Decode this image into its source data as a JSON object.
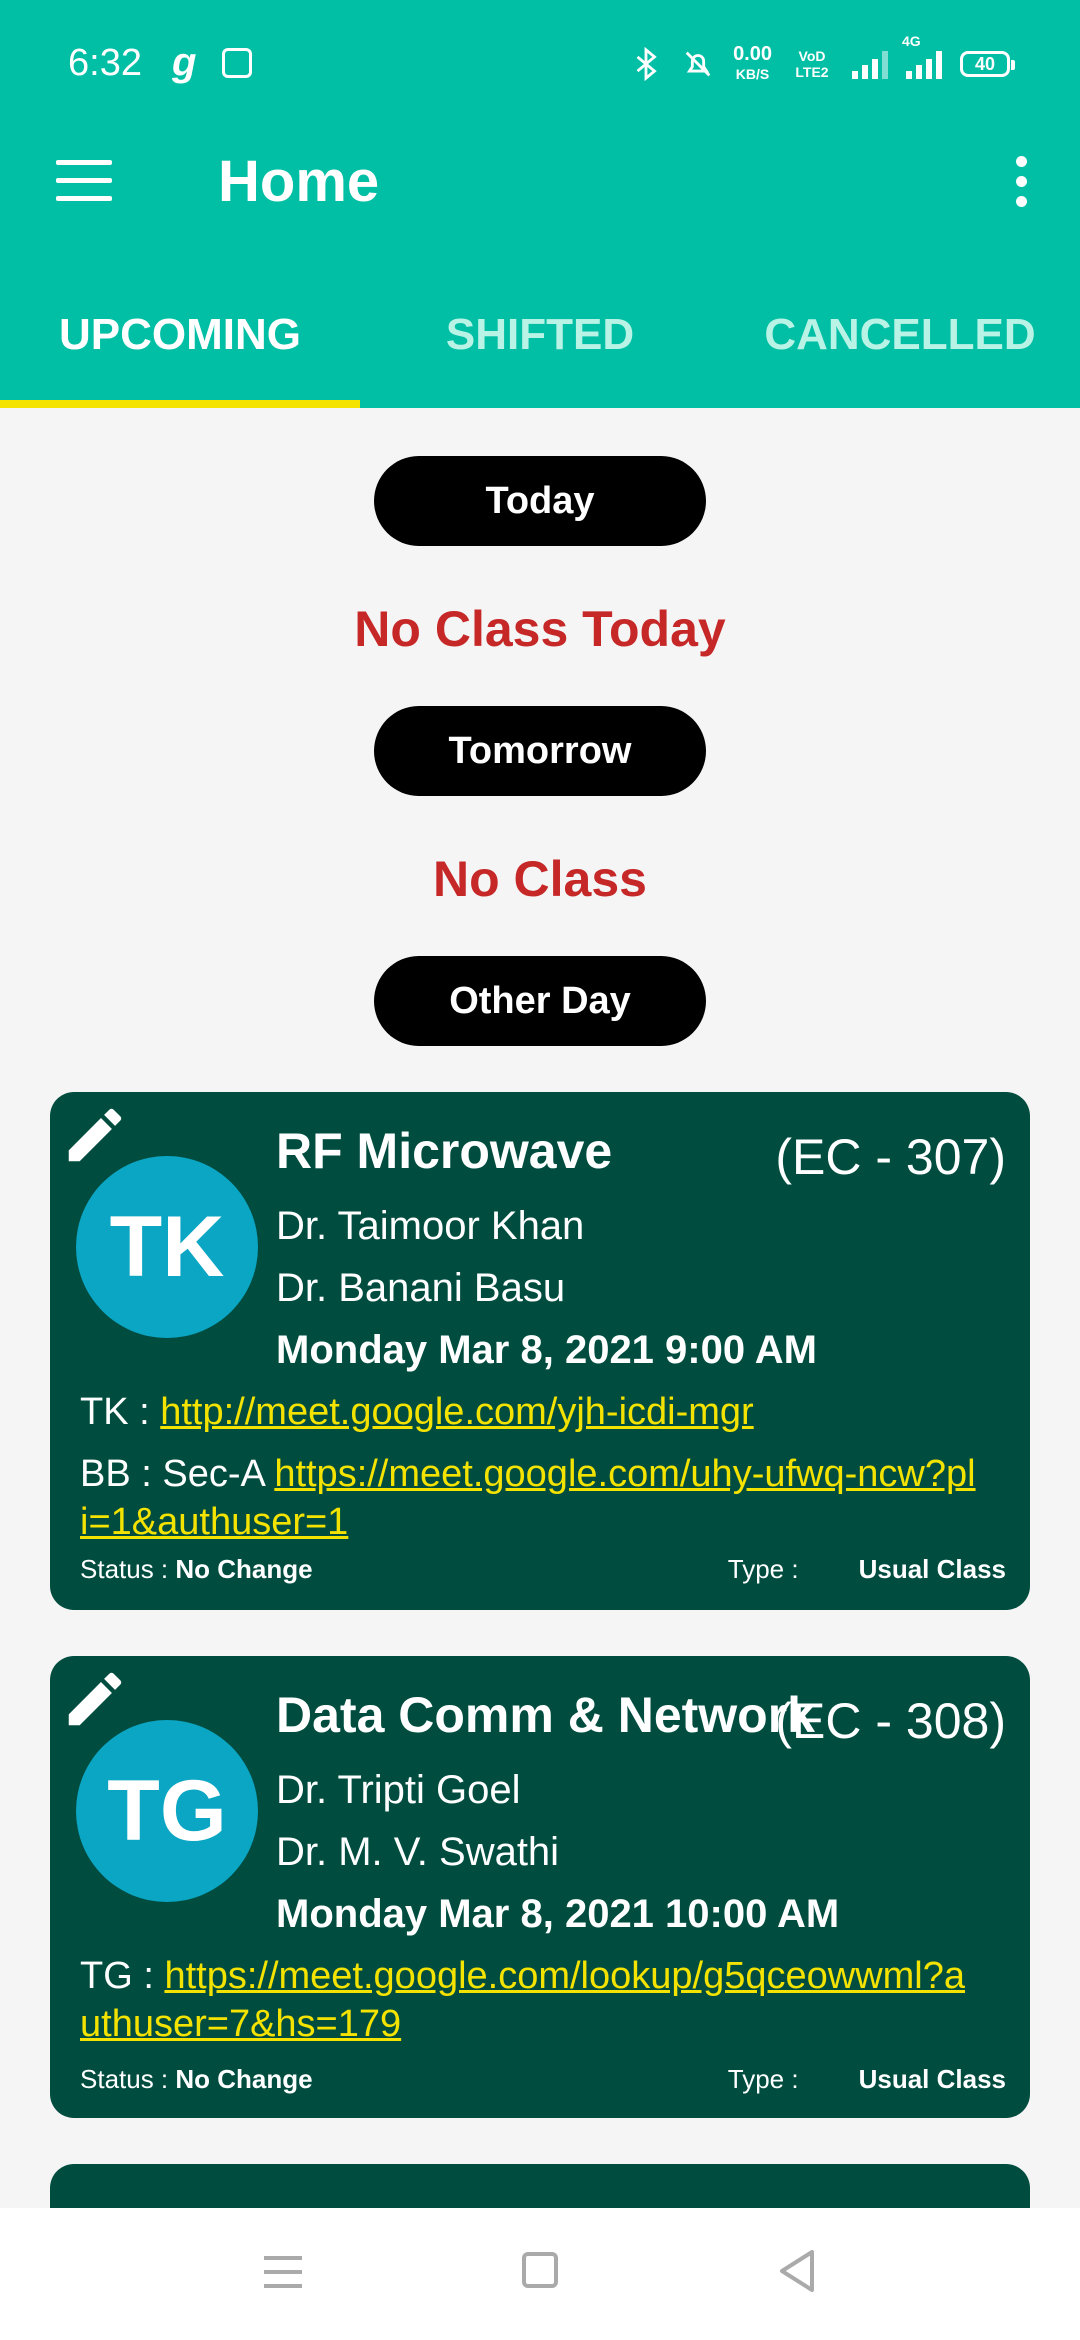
{
  "status_bar": {
    "time": "6:32",
    "speed": "0.00",
    "speed_unit": "KB/S",
    "volte": "VoD LTE2",
    "network": "4G",
    "battery": "40"
  },
  "toolbar": {
    "title": "Home"
  },
  "tabs": [
    {
      "label": "UPCOMING",
      "active": true
    },
    {
      "label": "SHIFTED",
      "active": false
    },
    {
      "label": "CANCELLED",
      "active": false
    }
  ],
  "sections": {
    "today_label": "Today",
    "today_message": "No Class Today",
    "tomorrow_label": "Tomorrow",
    "tomorrow_message": "No Class",
    "other_day_label": "Other Day"
  },
  "classes": [
    {
      "initials": "TK",
      "subject": "RF Microwave",
      "code": "(EC - 307)",
      "teachers": [
        "Dr. Taimoor Khan",
        "Dr. Banani Basu"
      ],
      "datetime": "Monday Mar 8, 2021 9:00 AM",
      "links": [
        {
          "prefix": "TK : ",
          "url": "http://meet.google.com/yjh-icdi-mgr"
        },
        {
          "prefix": "BB : Sec-A ",
          "url": "https://meet.google.com/uhy-ufwq-ncw?pli=1&authuser=1"
        }
      ],
      "status_label": "Status : ",
      "status_value": "No Change",
      "type_label": "Type :",
      "type_value": "Usual Class"
    },
    {
      "initials": "TG",
      "subject": "Data Comm & Network",
      "code": "(EC - 308)",
      "teachers": [
        "Dr. Tripti Goel",
        "Dr. M. V. Swathi"
      ],
      "datetime": "Monday Mar 8, 2021 10:00 AM",
      "links": [
        {
          "prefix": "TG : ",
          "url": "https://meet.google.com/lookup/g5qceowwml?authuser=7&hs=179"
        }
      ],
      "status_label": "Status : ",
      "status_value": "No Change",
      "type_label": "Type :",
      "type_value": "Usual Class"
    }
  ],
  "colors": {
    "primary": "#00bfa5",
    "card": "#004d40",
    "accent": "#f4e200",
    "alert": "#c62828",
    "avatar": "#0aa6c4"
  }
}
